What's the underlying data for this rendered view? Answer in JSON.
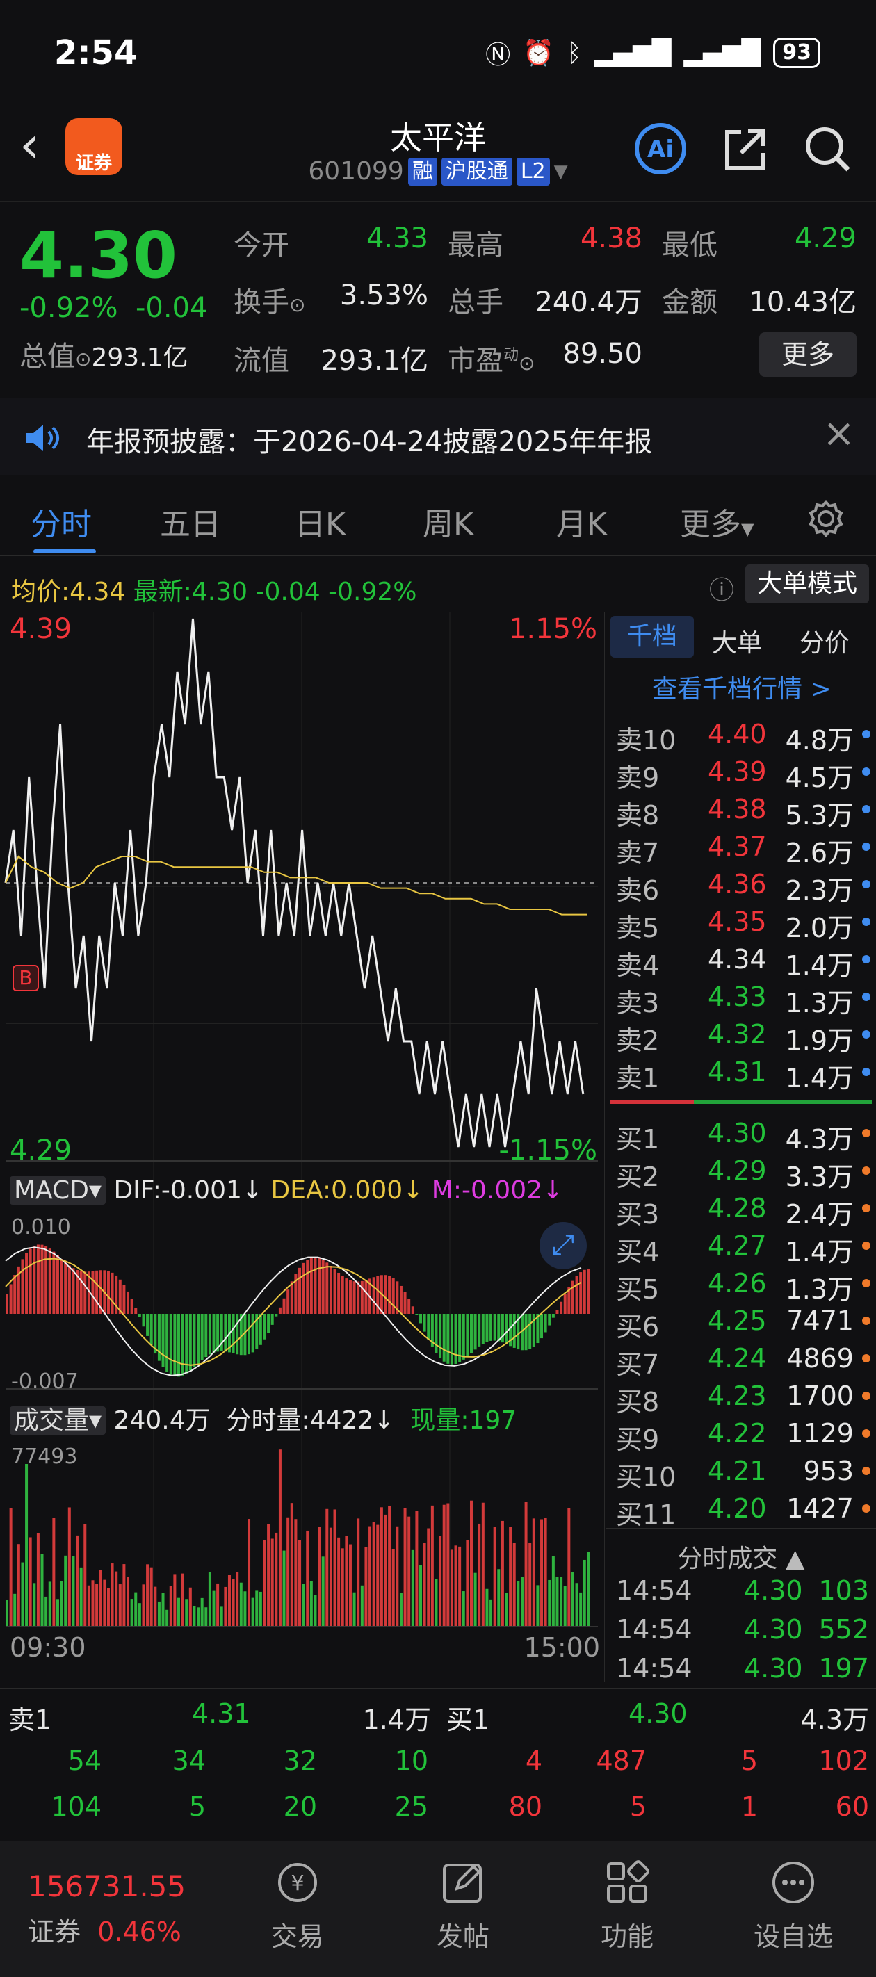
{
  "status_bar": {
    "time": "2:54",
    "battery": "93"
  },
  "header": {
    "logo_text": "证券",
    "stock_name": "太平洋",
    "stock_code": "601099",
    "tags": [
      "融",
      "沪股通",
      "L2"
    ]
  },
  "quote": {
    "last": "4.30",
    "change_pct": "-0.92%",
    "change": "-0.04",
    "open_label": "今开",
    "open": "4.33",
    "high_label": "最高",
    "high": "4.38",
    "low_label": "最低",
    "low": "4.29",
    "turnover_label": "换手",
    "turnover": "3.53%",
    "volume_label": "总手",
    "volume": "240.4万",
    "amount_label": "金额",
    "amount": "10.43亿",
    "mktcap_label": "总值",
    "mktcap": "293.1亿",
    "float_label": "流值",
    "float": "293.1亿",
    "pe_label": "市盈",
    "pe_sup": "动",
    "pe": "89.50",
    "more": "更多"
  },
  "notice": {
    "text": "年报预披露：于2026-04-24披露2025年年报"
  },
  "tabs": [
    "分时",
    "五日",
    "日K",
    "周K",
    "月K",
    "更多"
  ],
  "avg_bar": {
    "avg_label": "均价:",
    "avg": "4.34",
    "latest_label": "最新:",
    "latest": "4.30",
    "chg": "-0.04",
    "pct": "-0.92%",
    "mode_btn": "大单模式"
  },
  "chart_data": [
    {
      "type": "line",
      "name": "intraday",
      "ymax": "4.39",
      "ymin": "4.29",
      "pmax": "1.15%",
      "pmin": "-1.15%",
      "ref": 4.34,
      "marker": "B",
      "price": [
        4.34,
        4.35,
        4.33,
        4.36,
        4.34,
        4.32,
        4.35,
        4.37,
        4.34,
        4.32,
        4.33,
        4.31,
        4.33,
        4.32,
        4.34,
        4.33,
        4.35,
        4.33,
        4.34,
        4.36,
        4.37,
        4.36,
        4.38,
        4.37,
        4.39,
        4.37,
        4.38,
        4.36,
        4.36,
        4.35,
        4.36,
        4.34,
        4.35,
        4.33,
        4.35,
        4.33,
        4.34,
        4.33,
        4.35,
        4.33,
        4.34,
        4.33,
        4.34,
        4.33,
        4.34,
        4.33,
        4.32,
        4.33,
        4.32,
        4.31,
        4.32,
        4.31,
        4.31,
        4.3,
        4.31,
        4.3,
        4.31,
        4.3,
        4.29,
        4.3,
        4.29,
        4.3,
        4.29,
        4.3,
        4.29,
        4.3,
        4.31,
        4.3,
        4.32,
        4.31,
        4.3,
        4.31,
        4.3,
        4.31,
        4.3
      ],
      "avg": [
        4.34,
        4.345,
        4.343,
        4.342,
        4.34,
        4.339,
        4.34,
        4.343,
        4.344,
        4.345,
        4.345,
        4.344,
        4.344,
        4.343,
        4.343,
        4.343,
        4.343,
        4.343,
        4.343,
        4.343,
        4.342,
        4.342,
        4.341,
        4.341,
        4.341,
        4.34,
        4.34,
        4.34,
        4.34,
        4.339,
        4.339,
        4.339,
        4.338,
        4.338,
        4.337,
        4.337,
        4.337,
        4.336,
        4.336,
        4.335,
        4.335,
        4.335,
        4.335,
        4.334,
        4.334,
        4.334
      ]
    },
    {
      "type": "line",
      "name": "MACD",
      "indicator": "MACD",
      "dif_label": "DIF:-0.001↓",
      "dea_label": "DEA:0.000↓",
      "m_label": "M:-0.002↓",
      "ymax": "0.010",
      "ymin": "-0.007"
    },
    {
      "type": "bar",
      "name": "volume",
      "label": "成交量",
      "total": "240.4万",
      "fs_label": "分时量:4422↓",
      "now_label": "现量:",
      "now": "197",
      "ymax": "77493",
      "xstart": "09:30",
      "xend": "15:00"
    }
  ],
  "orderbook": {
    "tabs": [
      "千档",
      "大单",
      "分价"
    ],
    "link": "查看千档行情 >",
    "asks": [
      [
        "卖10",
        "4.40",
        "4.8万"
      ],
      [
        "卖9",
        "4.39",
        "4.5万"
      ],
      [
        "卖8",
        "4.38",
        "5.3万"
      ],
      [
        "卖7",
        "4.37",
        "2.6万"
      ],
      [
        "卖6",
        "4.36",
        "2.3万"
      ],
      [
        "卖5",
        "4.35",
        "2.0万"
      ],
      [
        "卖4",
        "4.34",
        "1.4万"
      ],
      [
        "卖3",
        "4.33",
        "1.3万"
      ],
      [
        "卖2",
        "4.32",
        "1.9万"
      ],
      [
        "卖1",
        "4.31",
        "1.4万"
      ]
    ],
    "bids": [
      [
        "买1",
        "4.30",
        "4.3万"
      ],
      [
        "买2",
        "4.29",
        "3.3万"
      ],
      [
        "买3",
        "4.28",
        "2.4万"
      ],
      [
        "买4",
        "4.27",
        "1.4万"
      ],
      [
        "买5",
        "4.26",
        "1.3万"
      ],
      [
        "买6",
        "4.25",
        "7471"
      ],
      [
        "买7",
        "4.24",
        "4869"
      ],
      [
        "买8",
        "4.23",
        "1700"
      ],
      [
        "买9",
        "4.22",
        "1129"
      ],
      [
        "买10",
        "4.21",
        "953"
      ],
      [
        "买11",
        "4.20",
        "1427"
      ]
    ],
    "ticks_title": "分时成交",
    "ticks": [
      [
        "14:54",
        "4.30",
        "103"
      ],
      [
        "14:54",
        "4.30",
        "552"
      ],
      [
        "14:54",
        "4.30",
        "197"
      ]
    ]
  },
  "bottom_book": {
    "sell_label": "卖1",
    "sell_price": "4.31",
    "sell_vol": "1.4万",
    "buy_label": "买1",
    "buy_price": "4.30",
    "buy_vol": "4.3万",
    "sell_row1": [
      "54",
      "34",
      "32",
      "10"
    ],
    "sell_row2": [
      "104",
      "5",
      "20",
      "25"
    ],
    "buy_row1": [
      "4",
      "487",
      "5",
      "102"
    ],
    "buy_row2": [
      "80",
      "5",
      "1",
      "60"
    ]
  },
  "tabbar": {
    "index": "156731.55",
    "index_label": "证券",
    "index_pct": "0.46%",
    "items": [
      "交易",
      "发帖",
      "功能",
      "设自选"
    ]
  }
}
